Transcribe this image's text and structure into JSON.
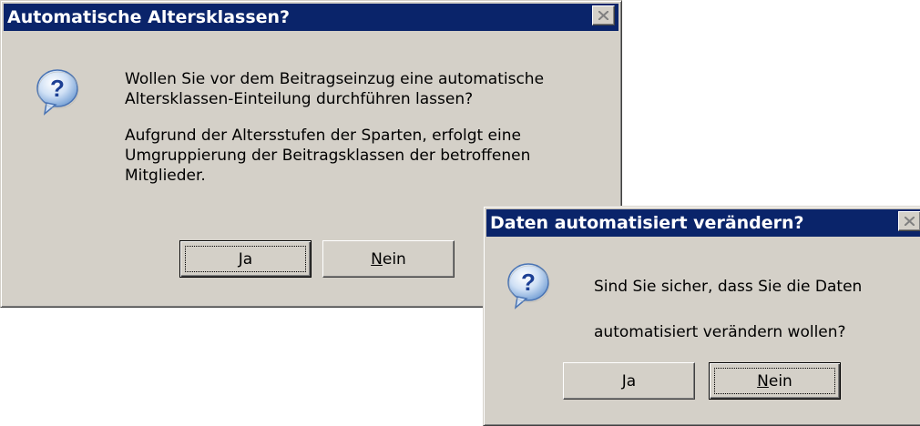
{
  "dialog1": {
    "title": "Automatische Altersklassen?",
    "icon": "question-icon",
    "message_lines": [
      "Wollen Sie vor dem Beitragseinzug eine automatische",
      "Altersklassen-Einteilung durchführen lassen?",
      "",
      "Aufgrund der Altersstufen der Sparten, erfolgt eine",
      "Umgruppierung der Beitragsklassen der betroffenen",
      "Mitglieder."
    ],
    "yes_label": {
      "mnemonic": "J",
      "rest": "a"
    },
    "no_label": {
      "mnemonic": "N",
      "rest": "ein"
    },
    "default_button": "yes"
  },
  "dialog2": {
    "title": "Daten automatisiert verändern?",
    "icon": "question-icon",
    "message_lines": [
      "Sind Sie sicher, dass Sie die Daten",
      "automatisiert verändern wollen?"
    ],
    "yes_label": {
      "mnemonic": "J",
      "rest": "a"
    },
    "no_label": {
      "mnemonic": "N",
      "rest": "ein"
    },
    "default_button": "no"
  },
  "colors": {
    "titlebar": "#0a246a",
    "dialog_face": "#d4d0c8",
    "title_text": "#ffffff"
  }
}
